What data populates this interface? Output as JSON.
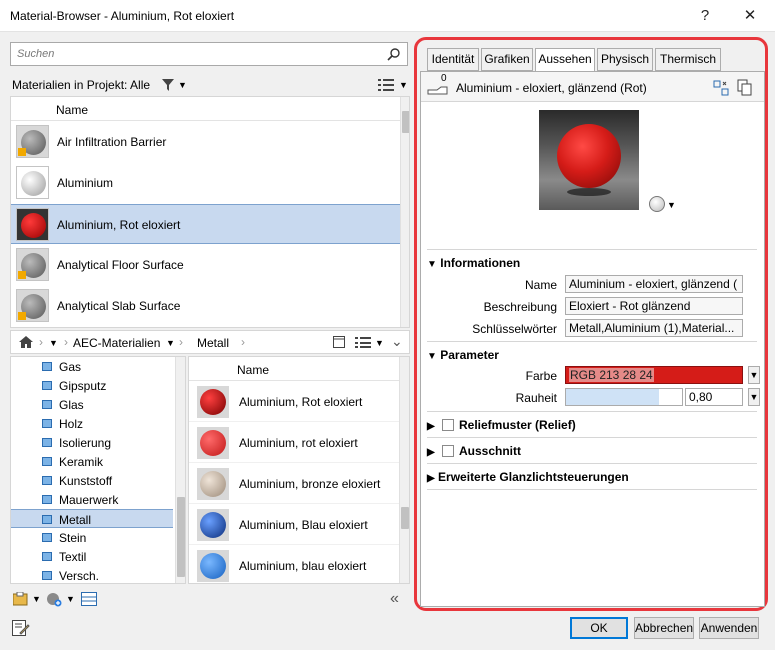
{
  "window": {
    "title": "Material-Browser - Aluminium, Rot eloxiert",
    "help": "?",
    "close": "✕"
  },
  "search": {
    "placeholder": "Suchen"
  },
  "project_filter": {
    "label": "Materialien in Projekt: Alle"
  },
  "project_list": {
    "header": "Name",
    "rows": [
      {
        "label": "Air Infiltration Barrier",
        "color": "#6a6a6a"
      },
      {
        "label": "Aluminium",
        "color": "#cfcfcf"
      },
      {
        "label": "Aluminium, Rot eloxiert",
        "color": "#c00000"
      },
      {
        "label": "Analytical Floor Surface",
        "color": "#6a6a6a"
      },
      {
        "label": "Analytical Slab Surface",
        "color": "#6a6a6a"
      }
    ]
  },
  "breadcrumb": {
    "library": "AEC-Materialien",
    "category": "Metall"
  },
  "tree": {
    "items": [
      "Gas",
      "Gipsputz",
      "Glas",
      "Holz",
      "Isolierung",
      "Keramik",
      "Kunststoff",
      "Mauerwerk",
      "Metall",
      "Stein",
      "Textil",
      "Versch."
    ],
    "selected": "Metall"
  },
  "library_list": {
    "header": "Name",
    "rows": [
      {
        "label": "Aluminium, Rot eloxiert",
        "color": "#b0151c"
      },
      {
        "label": "Aluminium, rot eloxiert",
        "color": "#e03030"
      },
      {
        "label": "Aluminium, bronze eloxiert",
        "color": "#c9b8a6"
      },
      {
        "label": "Aluminium, Blau eloxiert",
        "color": "#1a4fb0"
      },
      {
        "label": "Aluminium, blau eloxiert",
        "color": "#2a7de0"
      }
    ]
  },
  "editor": {
    "tabs": [
      "Identität",
      "Grafiken",
      "Aussehen",
      "Physisch",
      "Thermisch"
    ],
    "active_tab": "Aussehen",
    "asset_count": "0",
    "asset_name": "Aluminium - eloxiert, glänzend (Rot)",
    "info": {
      "section": "Informationen",
      "name_label": "Name",
      "name_value": "Aluminium - eloxiert, glänzend (",
      "desc_label": "Beschreibung",
      "desc_value": "Eloxiert - Rot glänzend",
      "keywords_label": "Schlüsselwörter",
      "keywords_value": "Metall,Aluminium (1),Material..."
    },
    "params": {
      "section": "Parameter",
      "color_label": "Farbe",
      "color_value": "RGB 213 28 24",
      "color_hex": "#d51c18",
      "roughness_label": "Rauheit",
      "roughness_value": "0,80",
      "roughness_fraction": 0.8
    },
    "relief": "Reliefmuster (Relief)",
    "cutout": "Ausschnitt",
    "highlights": "Erweiterte Glanzlichtsteuerungen"
  },
  "buttons": {
    "ok": "OK",
    "cancel": "Abbrechen",
    "apply": "Anwenden"
  },
  "accent": "#e8363c"
}
